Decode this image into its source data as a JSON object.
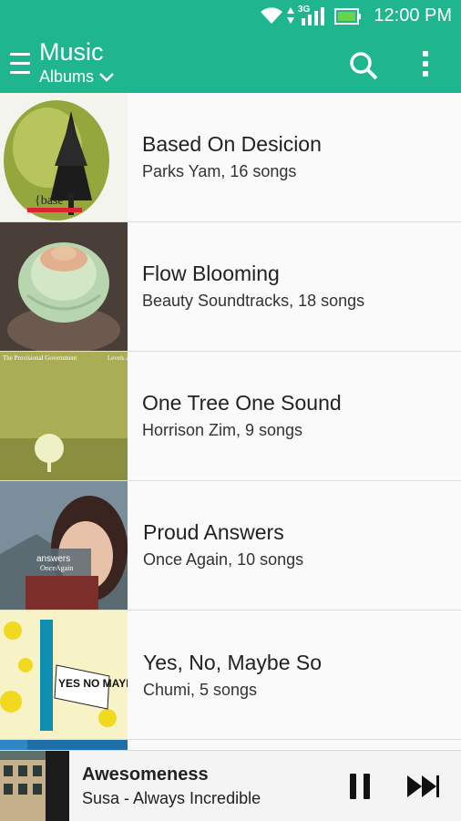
{
  "status": {
    "network": "3G",
    "time": "12:00 PM"
  },
  "app": {
    "title": "Music",
    "view": "Albums"
  },
  "icons": {
    "menu": "menu-icon",
    "dropdown": "chevron-down-icon",
    "search": "search-icon",
    "overflow": "overflow-menu-icon",
    "pause": "pause-icon",
    "fast_forward": "fast-forward-icon"
  },
  "colors": {
    "accent": "#1fb68f",
    "battery": "#6bd34a"
  },
  "albums": [
    {
      "title": "Based On Desicion",
      "subtitle": "Parks Yam, 16 songs",
      "art_text": "{base"
    },
    {
      "title": "Flow Blooming",
      "subtitle": "Beauty Soundtracks, 18 songs",
      "art_text": ""
    },
    {
      "title": "One Tree One Sound",
      "subtitle": "Horrison Zim, 9 songs",
      "art_text": "The Provisional Government",
      "art_text2": "Levels an"
    },
    {
      "title": "Proud Answers",
      "subtitle": "Once Again, 10 songs",
      "art_text": "answers",
      "art_text2": "OnceAgain"
    },
    {
      "title": "Yes, No, Maybe So",
      "subtitle": "Chumi, 5 songs",
      "art_text": "YES NO MAYBE"
    }
  ],
  "now_playing": {
    "title": "Awesomeness",
    "subtitle": "Susa - Always Incredible"
  }
}
